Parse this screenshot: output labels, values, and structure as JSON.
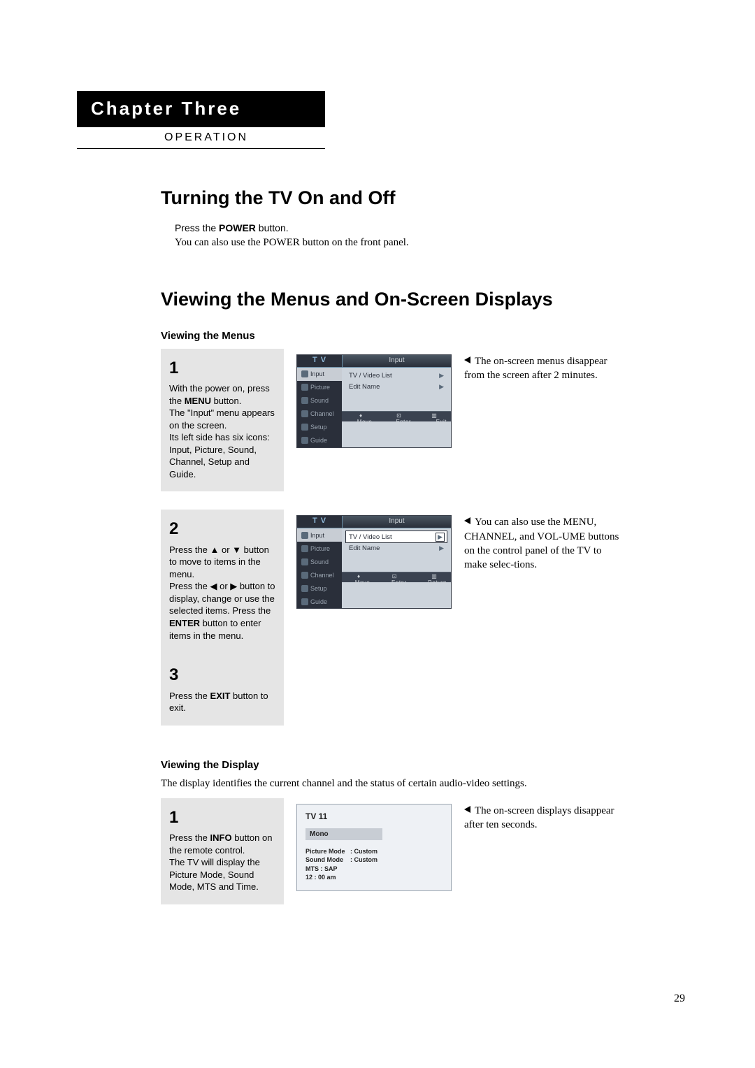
{
  "chapter": {
    "title": "Chapter Three",
    "subtitle": "OPERATION"
  },
  "section1": {
    "title": "Turning the TV On and Off",
    "line1_a": "Press the ",
    "line1_b": "POWER",
    "line1_c": " button.",
    "line2": "You can also use the POWER button on the front panel."
  },
  "section2": {
    "title": "Viewing the Menus and On-Screen Displays",
    "sub1": "Viewing the Menus",
    "sub2": "Viewing the Display",
    "display_desc": "The display identifies the current channel and the status of certain audio-video settings."
  },
  "steps_menu": {
    "s1": {
      "num": "1",
      "a": "With the power on, press the ",
      "b": "MENU",
      "c": " button.",
      "d": "The \"Input\" menu appears on the screen.",
      "e": "Its left side has six icons: Input, Picture, Sound, Channel, Setup and Guide."
    },
    "s2": {
      "num": "2",
      "a": "Press the ▲ or ▼ button to move to items in the menu.",
      "b": "Press the ◀ or ▶ button to display, change or use the selected items. Press the ",
      "c": "ENTER",
      "d": " button to enter items in the menu."
    },
    "s3": {
      "num": "3",
      "a": "Press the ",
      "b": "EXIT",
      "c": " button to exit."
    }
  },
  "steps_display": {
    "s1": {
      "num": "1",
      "a": "Press the ",
      "b": "INFO",
      "c": " button on the remote control.",
      "d": "The TV will display the Picture Mode, Sound Mode, MTS and Time."
    }
  },
  "osd1": {
    "tv": "T V",
    "title": "Input",
    "left": [
      "Input",
      "Picture",
      "Sound",
      "Channel",
      "Setup",
      "Guide"
    ],
    "rows": [
      {
        "label": "TV / Video List",
        "arrow": "▶"
      },
      {
        "label": "Edit Name",
        "arrow": "▶"
      }
    ],
    "footer": {
      "move": "Move",
      "enter": "Enter",
      "exit": "Exit"
    }
  },
  "osd2": {
    "tv": "T V",
    "title": "Input",
    "left": [
      "Input",
      "Picture",
      "Sound",
      "Channel",
      "Setup",
      "Guide"
    ],
    "rows": [
      {
        "label": "TV / Video List",
        "arrow": "▶",
        "sel": true
      },
      {
        "label": "Edit Name",
        "arrow": "▶"
      }
    ],
    "footer": {
      "move": "Move",
      "enter": "Enter",
      "ret": "Return"
    }
  },
  "info_osd": {
    "ch": "TV 11",
    "audio": "Mono",
    "picture_mode_label": "Picture Mode",
    "picture_mode_val": ": Custom",
    "sound_mode_label": "Sound Mode",
    "sound_mode_val": ": Custom",
    "mts_label": "MTS : SAP",
    "time": "12 : 00 am"
  },
  "notes": {
    "n1": "The on-screen menus disappear from the screen after 2 minutes.",
    "n2": "You can also use the MENU, CHANNEL, and VOL-UME buttons on the control panel of the TV to make selec-tions.",
    "n3": "The on-screen displays disappear after ten seconds."
  },
  "page_number": "29"
}
